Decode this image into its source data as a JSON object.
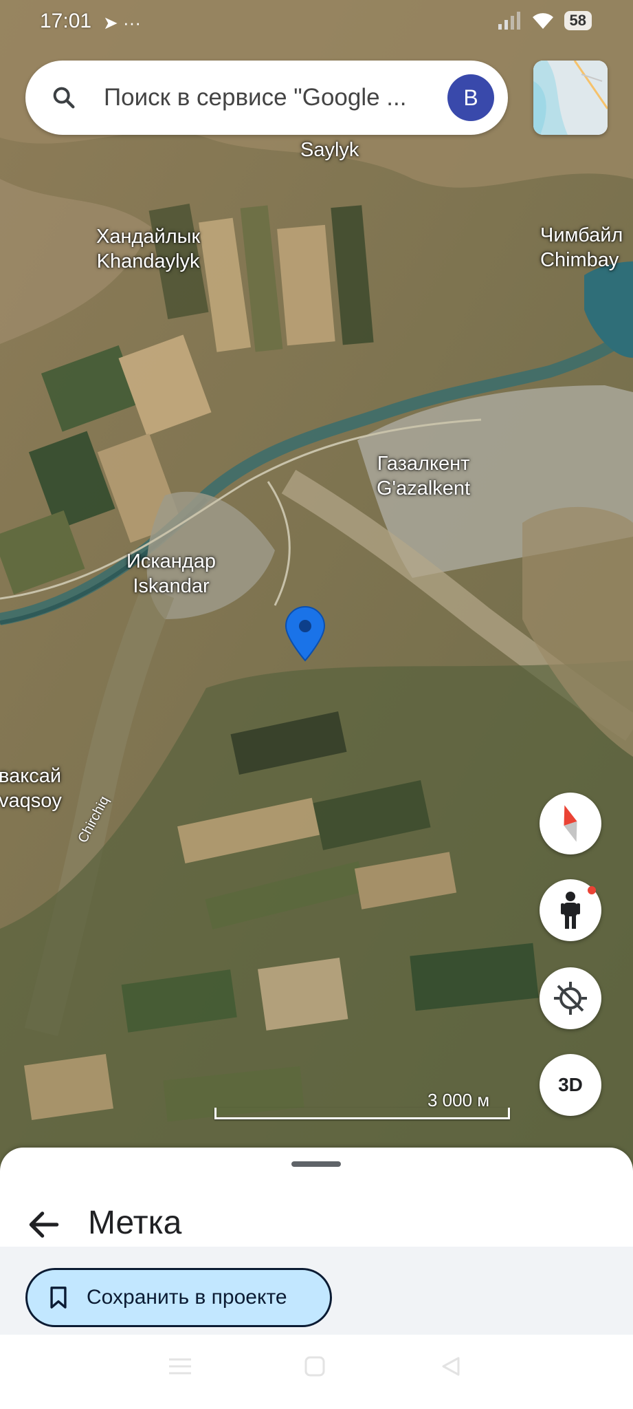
{
  "status_bar": {
    "time": "17:01",
    "extra": "➤ ···",
    "battery": "58"
  },
  "search": {
    "placeholder": "Поиск в сервисе \"Google ...",
    "avatar_letter": "B"
  },
  "map_labels": {
    "saylyk": "Saylyk",
    "khandaylyk_ru": "Хандайлык",
    "khandaylyk_lat": "Khandaylyk",
    "chimbay_ru": "Чимбайл",
    "chimbay_lat": "Chimbay",
    "gazalkent_ru": "Газалкент",
    "gazalkent_lat": "G'azalkent",
    "iskandar_ru": "Искандар",
    "iskandar_lat": "Iskandar",
    "vaksay_ru": "ваксай",
    "vaksay_lat": "vaqsoy",
    "river": "Chirchiq"
  },
  "controls": {
    "three_d": "3D"
  },
  "scale": {
    "label": "3 000 м"
  },
  "sheet": {
    "title": "Метка",
    "save_label": "Сохранить в проекте"
  },
  "colors": {
    "pin": "#1a73e8",
    "save_bg": "#c2e7ff",
    "avatar": "#3949ab"
  }
}
